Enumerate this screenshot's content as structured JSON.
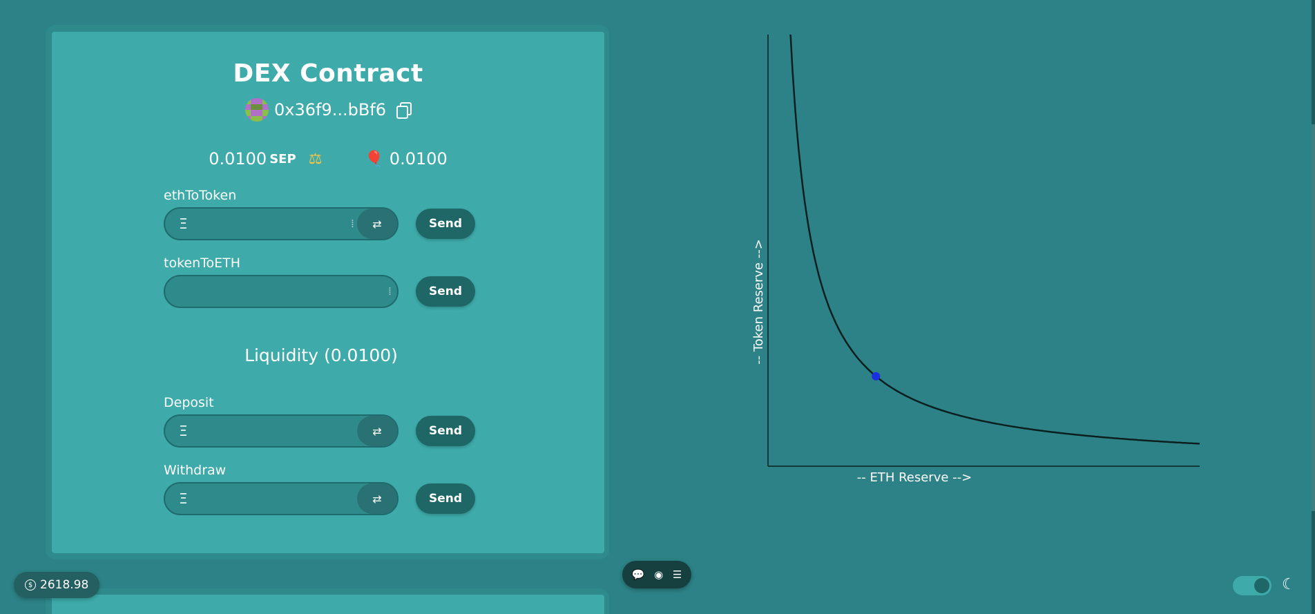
{
  "contract": {
    "title": "DEX Contract",
    "address": "0x36f9...bBf6",
    "eth_balance": "0.0100",
    "eth_unit": "SEP",
    "token_balance": "0.0100"
  },
  "methods": {
    "eth_to_token": {
      "label": "ethToToken",
      "prefix": "Ξ",
      "send": "Send"
    },
    "token_to_eth": {
      "label": "tokenToETH",
      "send": "Send"
    },
    "liquidity_heading": "Liquidity (0.0100)",
    "deposit": {
      "label": "Deposit",
      "prefix": "Ξ",
      "send": "Send"
    },
    "withdraw": {
      "label": "Withdraw",
      "prefix": "Ξ",
      "send": "Send"
    }
  },
  "chart_data": {
    "type": "line",
    "xlabel": "-- ETH Reserve -->",
    "ylabel": "-- Token Reserve -->",
    "series": [
      {
        "curve": "x*y=k",
        "current_point": {
          "x": 0.01,
          "y": 0.01
        }
      }
    ],
    "axes": "left-bottom"
  },
  "footer": {
    "eth_price": "2618.98"
  },
  "icons": {
    "copy": "copy-icon",
    "scale": "⚖",
    "balloon": "🎈",
    "swap": "⇄",
    "grip": "⁞",
    "moon": "☾"
  },
  "colors": {
    "background": "#2c8286",
    "card": "#3eabaa",
    "button": "#1f6666",
    "curve": "#0b1f1f",
    "point": "#1a2fe0"
  }
}
